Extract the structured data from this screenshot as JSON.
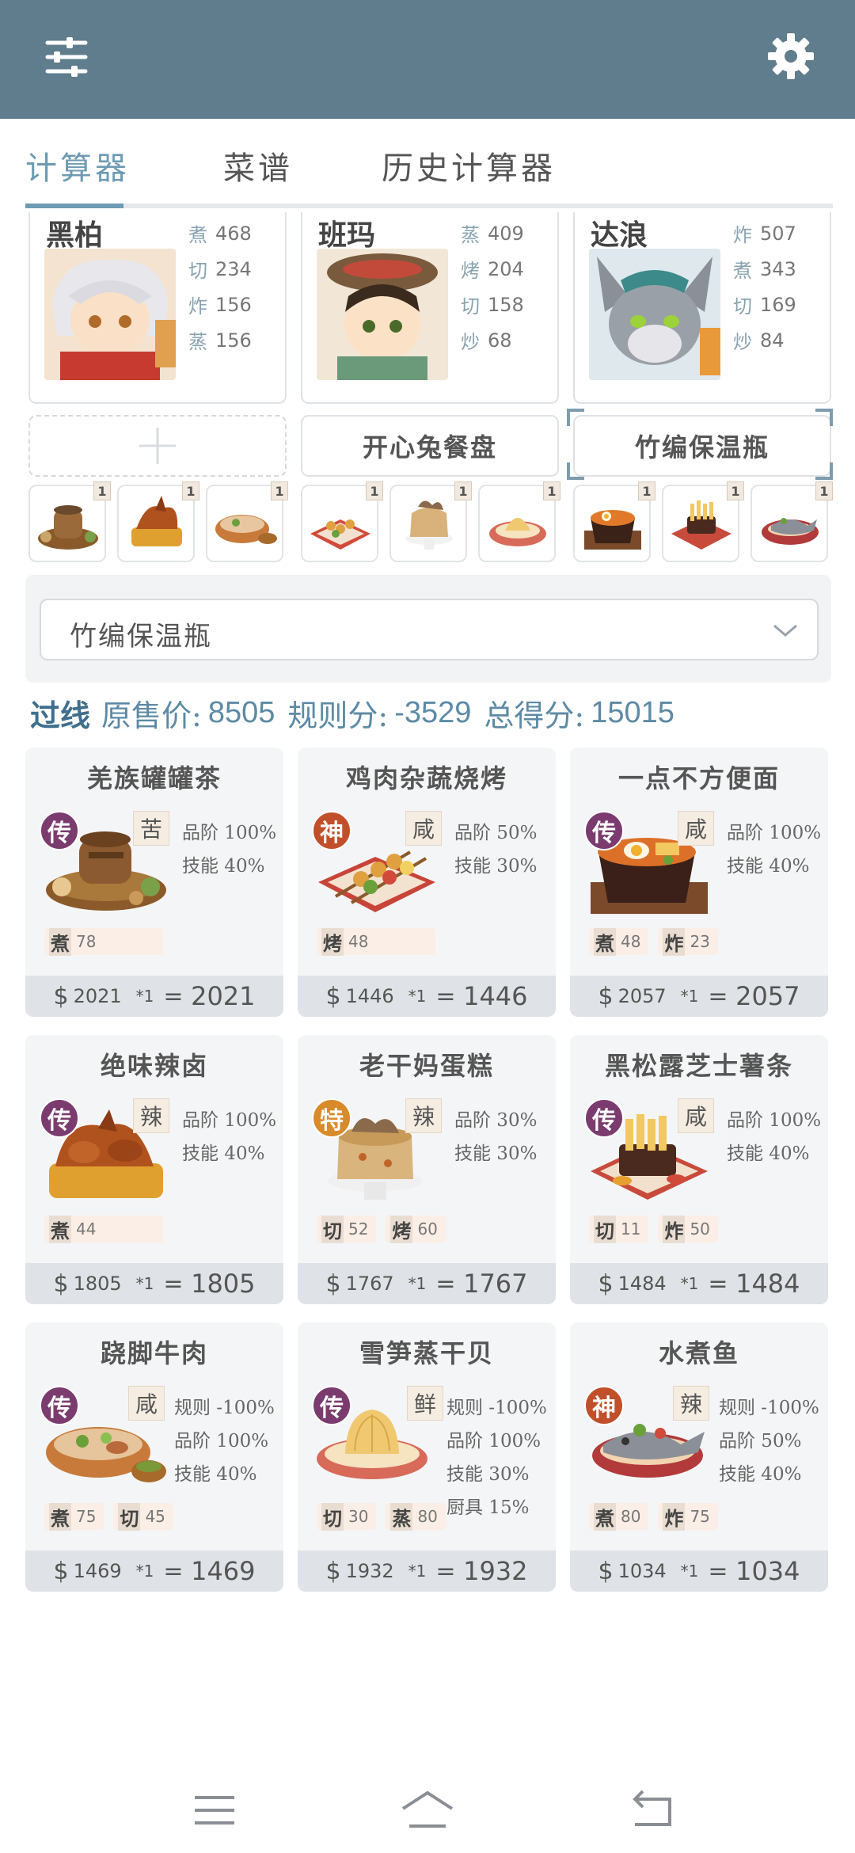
{
  "header": {
    "menu_icon": "sliders-icon",
    "settings_icon": "gear-icon"
  },
  "tabs": [
    {
      "label": "计算器",
      "active": true
    },
    {
      "label": "菜谱",
      "active": false
    },
    {
      "label": "历史计算器",
      "active": false
    }
  ],
  "chefs": [
    {
      "name": "黑柏",
      "skills": [
        {
          "k": "煮",
          "v": "468"
        },
        {
          "k": "切",
          "v": "234"
        },
        {
          "k": "炸",
          "v": "156"
        },
        {
          "k": "蒸",
          "v": "156"
        }
      ]
    },
    {
      "name": "班玛",
      "skills": [
        {
          "k": "蒸",
          "v": "409"
        },
        {
          "k": "烤",
          "v": "204"
        },
        {
          "k": "切",
          "v": "158"
        },
        {
          "k": "炒",
          "v": "68"
        }
      ]
    },
    {
      "name": "达浪",
      "skills": [
        {
          "k": "炸",
          "v": "507"
        },
        {
          "k": "煮",
          "v": "343"
        },
        {
          "k": "切",
          "v": "169"
        },
        {
          "k": "炒",
          "v": "84"
        }
      ]
    }
  ],
  "equipment": {
    "add_symbol": "+",
    "slot2": "开心兔餐盘",
    "slot3": "竹编保温瓶"
  },
  "mini_dishes": [
    {
      "qty": "1"
    },
    {
      "qty": "1"
    },
    {
      "qty": "1"
    },
    {
      "qty": "1"
    },
    {
      "qty": "1"
    },
    {
      "qty": "1"
    },
    {
      "qty": "1"
    },
    {
      "qty": "1"
    },
    {
      "qty": "1"
    }
  ],
  "selector": {
    "value": "竹编保温瓶"
  },
  "summary": {
    "pass": "过线",
    "original_label": "原售价:",
    "original_value": "8505",
    "rule_label": "规则分:",
    "rule_value": "-3529",
    "total_label": "总得分:",
    "total_value": "15015"
  },
  "dishes": [
    {
      "title": "羌族罐罐茶",
      "rarity": "传",
      "rarity_color": "#7b3b6e",
      "flavor": "苦",
      "stats": [
        "品阶 100%",
        "技能 40%"
      ],
      "skills": [
        {
          "k": "煮",
          "v": "78"
        }
      ],
      "price": "2021",
      "mult": "*1",
      "total": "2021"
    },
    {
      "title": "鸡肉杂蔬烧烤",
      "rarity": "神",
      "rarity_color": "#c1502a",
      "flavor": "咸",
      "stats": [
        "品阶 50%",
        "技能 30%"
      ],
      "skills": [
        {
          "k": "烤",
          "v": "48"
        }
      ],
      "price": "1446",
      "mult": "*1",
      "total": "1446"
    },
    {
      "title": "一点不方便面",
      "rarity": "传",
      "rarity_color": "#7b3b6e",
      "flavor": "咸",
      "stats": [
        "品阶 100%",
        "技能 40%"
      ],
      "skills": [
        {
          "k": "煮",
          "v": "48"
        },
        {
          "k": "炸",
          "v": "23"
        }
      ],
      "price": "2057",
      "mult": "*1",
      "total": "2057"
    },
    {
      "title": "绝味辣卤",
      "rarity": "传",
      "rarity_color": "#7b3b6e",
      "flavor": "辣",
      "stats": [
        "品阶 100%",
        "技能 40%"
      ],
      "skills": [
        {
          "k": "煮",
          "v": "44"
        }
      ],
      "price": "1805",
      "mult": "*1",
      "total": "1805"
    },
    {
      "title": "老干妈蛋糕",
      "rarity": "特",
      "rarity_color": "#d98a2a",
      "flavor": "辣",
      "stats": [
        "品阶 30%",
        "技能 30%"
      ],
      "skills": [
        {
          "k": "切",
          "v": "52"
        },
        {
          "k": "烤",
          "v": "60"
        }
      ],
      "price": "1767",
      "mult": "*1",
      "total": "1767"
    },
    {
      "title": "黑松露芝士薯条",
      "rarity": "传",
      "rarity_color": "#7b3b6e",
      "flavor": "咸",
      "stats": [
        "品阶 100%",
        "技能 40%"
      ],
      "skills": [
        {
          "k": "切",
          "v": "11"
        },
        {
          "k": "炸",
          "v": "50"
        }
      ],
      "price": "1484",
      "mult": "*1",
      "total": "1484"
    },
    {
      "title": "跷脚牛肉",
      "rarity": "传",
      "rarity_color": "#7b3b6e",
      "flavor": "咸",
      "stats": [
        "规则 -100%",
        "品阶 100%",
        "技能 40%"
      ],
      "skills": [
        {
          "k": "煮",
          "v": "75"
        },
        {
          "k": "切",
          "v": "45"
        }
      ],
      "price": "1469",
      "mult": "*1",
      "total": "1469"
    },
    {
      "title": "雪笋蒸干贝",
      "rarity": "传",
      "rarity_color": "#7b3b6e",
      "flavor": "鲜",
      "stats": [
        "规则 -100%",
        "品阶 100%",
        "技能 30%",
        "厨具 15%"
      ],
      "skills": [
        {
          "k": "切",
          "v": "30"
        },
        {
          "k": "蒸",
          "v": "80"
        }
      ],
      "price": "1932",
      "mult": "*1",
      "total": "1932"
    },
    {
      "title": "水煮鱼",
      "rarity": "神",
      "rarity_color": "#c1502a",
      "flavor": "辣",
      "stats": [
        "规则 -100%",
        "品阶 50%",
        "技能 40%"
      ],
      "skills": [
        {
          "k": "煮",
          "v": "80"
        },
        {
          "k": "炸",
          "v": "75"
        }
      ],
      "price": "1034",
      "mult": "*1",
      "total": "1034"
    }
  ],
  "price_symbol": "$",
  "price_eq": "=",
  "navbar": {
    "menu_icon": "menu-icon",
    "home_icon": "home-icon",
    "back_icon": "back-icon"
  }
}
